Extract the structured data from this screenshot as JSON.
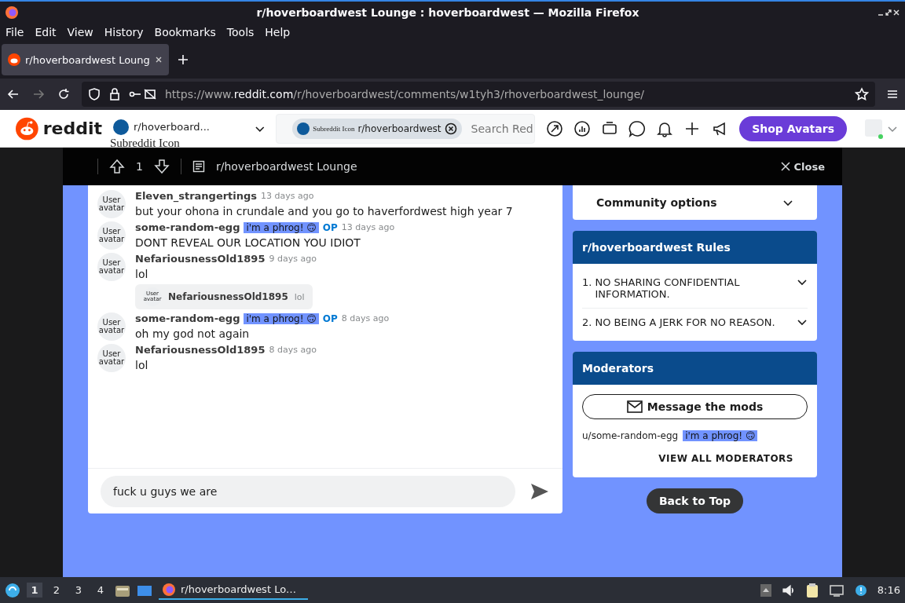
{
  "window": {
    "title": "r/hoverboardwest Lounge : hoverboardwest — Mozilla Firefox"
  },
  "menu_bar": [
    "File",
    "Edit",
    "View",
    "History",
    "Bookmarks",
    "Tools",
    "Help"
  ],
  "tabs": [
    {
      "label": "r/hoverboardwest Loung",
      "selected": true
    }
  ],
  "address_bar": {
    "url_prefix": "https://www.",
    "url_domain": "reddit.com",
    "url_path": "/r/hoverboardwest/comments/w1tyh3/rhoverboardwest_lounge/"
  },
  "reddit_header": {
    "logo": "reddit",
    "community": "r/hoverboard...",
    "community_icon_alt": "Subreddit Icon",
    "search_chip": "r/hoverboardwest",
    "search_chip_icon_alt": "Subreddit Icon",
    "search_placeholder": "Search Red",
    "shop_button": "Shop Avatars"
  },
  "post_bar": {
    "score": "1",
    "title": "r/hoverboardwest Lounge",
    "close": "Close"
  },
  "comments": [
    {
      "kind": "comment",
      "avatar_alt": "User avatar",
      "author": "Eleven_strangertings",
      "time": "13 days ago",
      "body": "but your ohona in crundale and you go to haverfordwest high year 7"
    },
    {
      "kind": "comment",
      "avatar_alt": "User avatar",
      "author": "some-random-egg",
      "flair": "i'm a phrog! 🙃",
      "op": "OP",
      "time": "13 days ago",
      "body": "DONT REVEAL OUR LOCATION YOU IDIOT"
    },
    {
      "kind": "comment",
      "avatar_alt": "User avatar",
      "author": "NefariousnessOld1895",
      "time": "9 days ago",
      "body": "lol"
    },
    {
      "kind": "reply_chip",
      "avatar_alt": "User avatar",
      "author": "NefariousnessOld1895",
      "body": "lol"
    },
    {
      "kind": "comment",
      "avatar_alt": "User avatar",
      "author": "some-random-egg",
      "flair": "i'm a phrog! 🙃",
      "op": "OP",
      "time": "8 days ago",
      "body": "oh my god not again"
    },
    {
      "kind": "comment",
      "avatar_alt": "User avatar",
      "author": "NefariousnessOld1895",
      "time": "8 days ago",
      "body": "lol"
    }
  ],
  "reply_box": {
    "value": "fuck u guys we are "
  },
  "sidebar": {
    "community_options": "Community options",
    "rules_title": "r/hoverboardwest Rules",
    "rules": [
      {
        "number": "1.",
        "text": "NO SHARING CONFIDENTIAL INFORMATION.",
        "expanded": false
      },
      {
        "number": "2.",
        "text": "NO BEING A JERK FOR NO REASON.",
        "expanded": false
      }
    ],
    "moderators_title": "Moderators",
    "message_button": "Message the mods",
    "moderators": [
      {
        "name": "u/some-random-egg",
        "flair": "i'm a phrog! 🙃"
      }
    ],
    "view_all": "VIEW ALL MODERATORS"
  },
  "back_to_top": "Back to Top",
  "taskbar": {
    "workspaces": [
      {
        "label": "1",
        "selected": true
      },
      {
        "label": "2",
        "selected": false
      },
      {
        "label": "3",
        "selected": false
      },
      {
        "label": "4",
        "selected": false
      }
    ],
    "task": "r/hoverboardwest Lo…",
    "clock": "8:16"
  }
}
